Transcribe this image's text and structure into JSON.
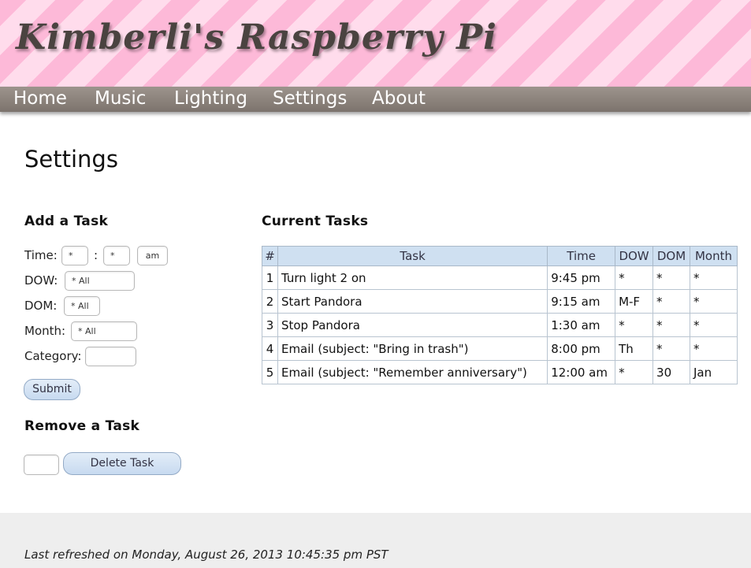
{
  "site": {
    "title": "Kimberli's Raspberry Pi"
  },
  "nav": {
    "items": [
      {
        "label": "Home"
      },
      {
        "label": "Music"
      },
      {
        "label": "Lighting"
      },
      {
        "label": "Settings"
      },
      {
        "label": "About"
      }
    ]
  },
  "page": {
    "title": "Settings"
  },
  "add_task": {
    "heading": "Add a Task",
    "time_label": "Time:",
    "time_sep": ":",
    "hour_value": "*",
    "minute_value": "*",
    "ampm_value": "am",
    "dow_label": "DOW:",
    "dow_value": "* All",
    "dom_label": "DOM:",
    "dom_value": "* All",
    "month_label": "Month:",
    "month_value": "* All",
    "category_label": "Category:",
    "category_value": "",
    "submit_label": "Submit"
  },
  "remove_task": {
    "heading": "Remove a Task",
    "id_value": "",
    "delete_label": "Delete Task"
  },
  "current_tasks": {
    "heading": "Current Tasks",
    "columns": [
      "#",
      "Task",
      "Time",
      "DOW",
      "DOM",
      "Month"
    ],
    "rows": [
      {
        "num": "1",
        "task": "Turn light 2 on",
        "time": "9:45 pm",
        "dow": "*",
        "dom": "*",
        "month": "*"
      },
      {
        "num": "2",
        "task": "Start Pandora",
        "time": "9:15 am",
        "dow": "M-F",
        "dom": "*",
        "month": "*"
      },
      {
        "num": "3",
        "task": "Stop Pandora",
        "time": "1:30 am",
        "dow": "*",
        "dom": "*",
        "month": "*"
      },
      {
        "num": "4",
        "task": "Email (subject: \"Bring in trash\")",
        "time": "8:00 pm",
        "dow": "Th",
        "dom": "*",
        "month": "*"
      },
      {
        "num": "5",
        "task": "Email (subject: \"Remember anniversary\")",
        "time": "12:00 am",
        "dow": "*",
        "dom": "30",
        "month": "Jan"
      }
    ]
  },
  "footer": {
    "text": "Last refreshed on Monday, August 26, 2013 10:45:35 pm PST"
  }
}
